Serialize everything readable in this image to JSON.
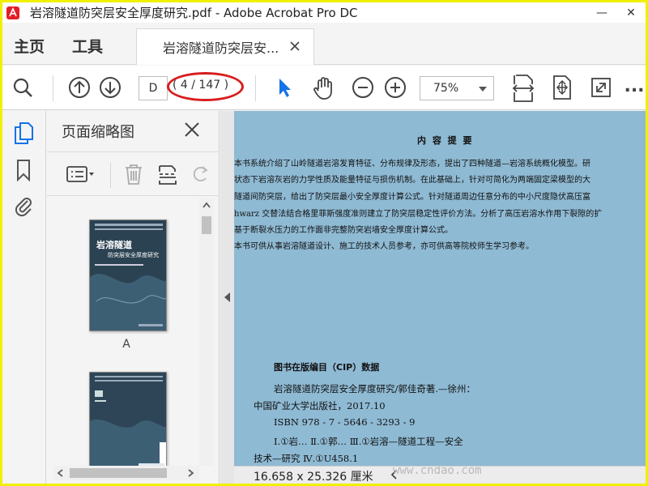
{
  "window": {
    "title": "岩溶隧道防突层安全厚度研究.pdf - Adobe Acrobat Pro DC",
    "minimize": "—",
    "close": "✕"
  },
  "menu": {
    "home": "主页",
    "tools": "工具",
    "doc_tab": "岩溶隧道防突层安..."
  },
  "toolbar": {
    "page_input": "D",
    "page_count": "( 4 / 147 )",
    "zoom": "75%",
    "more": "..."
  },
  "thumbnails": {
    "title": "页面缩略图",
    "pages": [
      {
        "label": "A",
        "cover_title": "岩溶隧道",
        "cover_subtitle": "防突层安全厚度研究"
      },
      {
        "label": ""
      }
    ]
  },
  "document": {
    "heading": "内 容 提 要",
    "paragraphs": [
      "    本书系统介绍了山岭隧道岩溶发育特征、分布规律及形态，提出了四种隧道—岩溶系统概化模型。研",
      "状态下岩溶灰岩的力学性质及能量特征与损伤机制。在此基础上，针对可简化为两端固定梁模型的大",
      "隧道间防突层，给出了防突层最小安全厚度计算公式。针对隧道周边任意分布的中小尺度隐伏高压富",
      "hwarz 交替法结合格里菲斯强度准则建立了防突层稳定性评价方法。分析了高压岩溶水作用下裂隙的扩",
      "基于断裂水压力的工作面非完整防突岩墙安全厚度计算公式。",
      "    本书可供从事岩溶隧道设计、施工的技术人员参考，亦可供高等院校师生学习参考。"
    ],
    "cip_title": "图书在版编目（CIP）数据",
    "cip_lines": [
      "岩溶隧道防突层安全厚度研究/郭佳奇著.—徐州：",
      "中国矿业大学出版社，2017.10",
      "ISBN 978 - 7 - 5646 - 3293 - 9",
      "Ⅰ.①岩…  Ⅱ.①郭…  Ⅲ.①岩溶—隧道工程—安全",
      "技术—研究  Ⅳ.①U458.1"
    ]
  },
  "status": {
    "page_size": "16.658 x 25.326 厘米",
    "watermark": "www.cndao.com"
  },
  "colors": {
    "accent": "#1473e6",
    "annotation": "#d81e1e",
    "page_bg": "#8fbad4"
  }
}
